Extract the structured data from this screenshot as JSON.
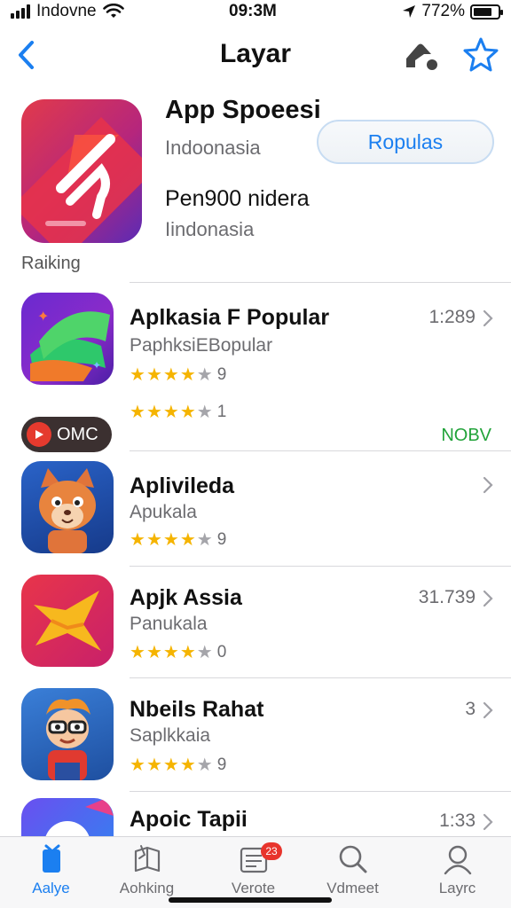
{
  "status_bar": {
    "carrier": "Indovne",
    "time": "09:3M",
    "battery": "772%",
    "battery_level": 0.77
  },
  "nav": {
    "title": "Layar"
  },
  "featured": {
    "title": "App Spoeesi",
    "subtitle": "Indoonasia",
    "button_label": "Ropulas",
    "line2": "Pen900 nidera",
    "line3": "Iindonasia",
    "section_label": "Raiking"
  },
  "list": [
    {
      "name": "Aplkasia F Popular",
      "sub": "PaphksiEBopular",
      "meta": "1:289",
      "rating": 4,
      "rating_text": "9",
      "badge_label": "OMC",
      "rating2": 4,
      "rating2_text": "1",
      "get_label": "NOBV"
    },
    {
      "name": "Aplivileda",
      "sub": "Apukala",
      "meta": "",
      "rating": 4,
      "rating_text": "9"
    },
    {
      "name": "Apjk Assia",
      "sub": "Panukala",
      "meta": "31.739",
      "rating": 4,
      "rating_text": "0"
    },
    {
      "name": "Nbeils Rahat",
      "sub": "Saplkkaia",
      "meta": "3",
      "rating": 4,
      "rating_text": "9"
    },
    {
      "name": "Apoic Tapii",
      "sub": "",
      "meta": "1:33",
      "rating": 0,
      "rating_text": ""
    }
  ],
  "tabs": [
    {
      "label": "Aalye",
      "icon": "today-icon",
      "active": true
    },
    {
      "label": "Aohking",
      "icon": "books-icon",
      "active": false
    },
    {
      "label": "Verote",
      "icon": "notes-icon",
      "active": false,
      "badge": "23"
    },
    {
      "label": "Vdmeet",
      "icon": "search-icon",
      "active": false
    },
    {
      "label": "Layrc",
      "icon": "account-icon",
      "active": false
    }
  ],
  "colors": {
    "accent": "#1b7ff0",
    "star": "#f5b400",
    "get": "#22a33a",
    "badge": "#e8342c"
  }
}
